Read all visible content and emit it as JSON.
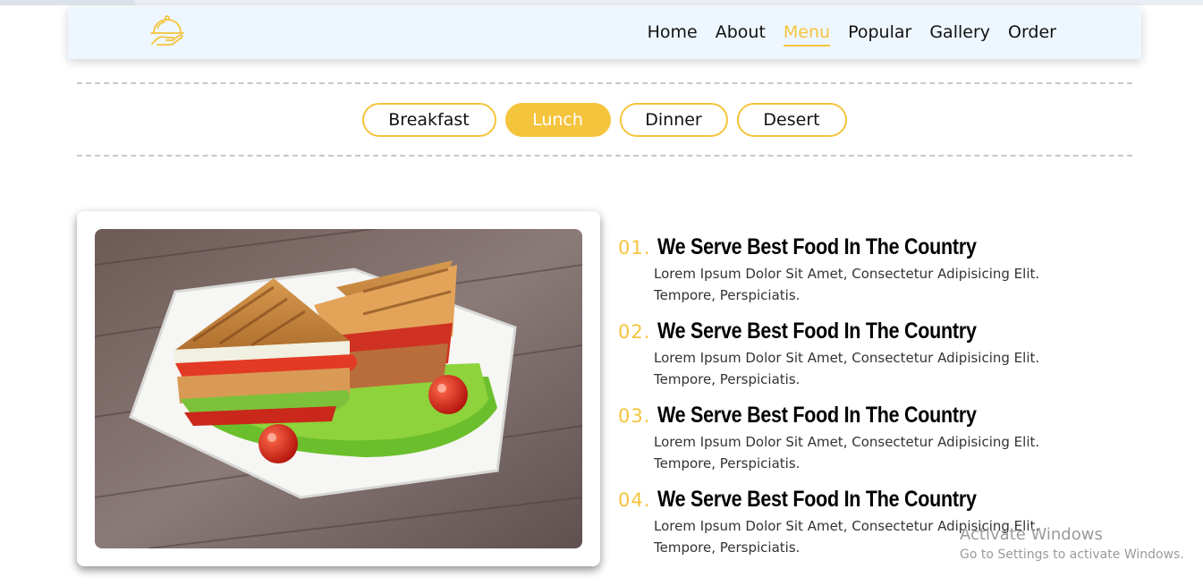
{
  "nav": {
    "logo_icon": "serving-cloche-hand-icon",
    "links": [
      "Home",
      "About",
      "Menu",
      "Popular",
      "Gallery",
      "Order"
    ],
    "active": "Menu"
  },
  "tabs": [
    "Breakfast",
    "Lunch",
    "Dinner",
    "Desert"
  ],
  "active_tab": "Lunch",
  "photo": {
    "subject": "sandwich-plate-image"
  },
  "items": [
    {
      "num": "01.",
      "title": "We Serve Best Food In The Country",
      "desc": "Lorem Ipsum Dolor Sit Amet, Consectetur Adipisicing Elit. Tempore, Perspiciatis."
    },
    {
      "num": "02.",
      "title": "We Serve Best Food In The Country",
      "desc": "Lorem Ipsum Dolor Sit Amet, Consectetur Adipisicing Elit. Tempore, Perspiciatis."
    },
    {
      "num": "03.",
      "title": "We Serve Best Food In The Country",
      "desc": "Lorem Ipsum Dolor Sit Amet, Consectetur Adipisicing Elit. Tempore, Perspiciatis."
    },
    {
      "num": "04.",
      "title": "We Serve Best Food In The Country",
      "desc": "Lorem Ipsum Dolor Sit Amet, Consectetur Adipisicing Elit. Tempore, Perspiciatis."
    }
  ],
  "watermark": {
    "line1": "Activate Windows",
    "line2": "Go to Settings to activate Windows."
  },
  "colors": {
    "accent": "#f5c43d",
    "navbar_bg": "#eef6ff"
  }
}
